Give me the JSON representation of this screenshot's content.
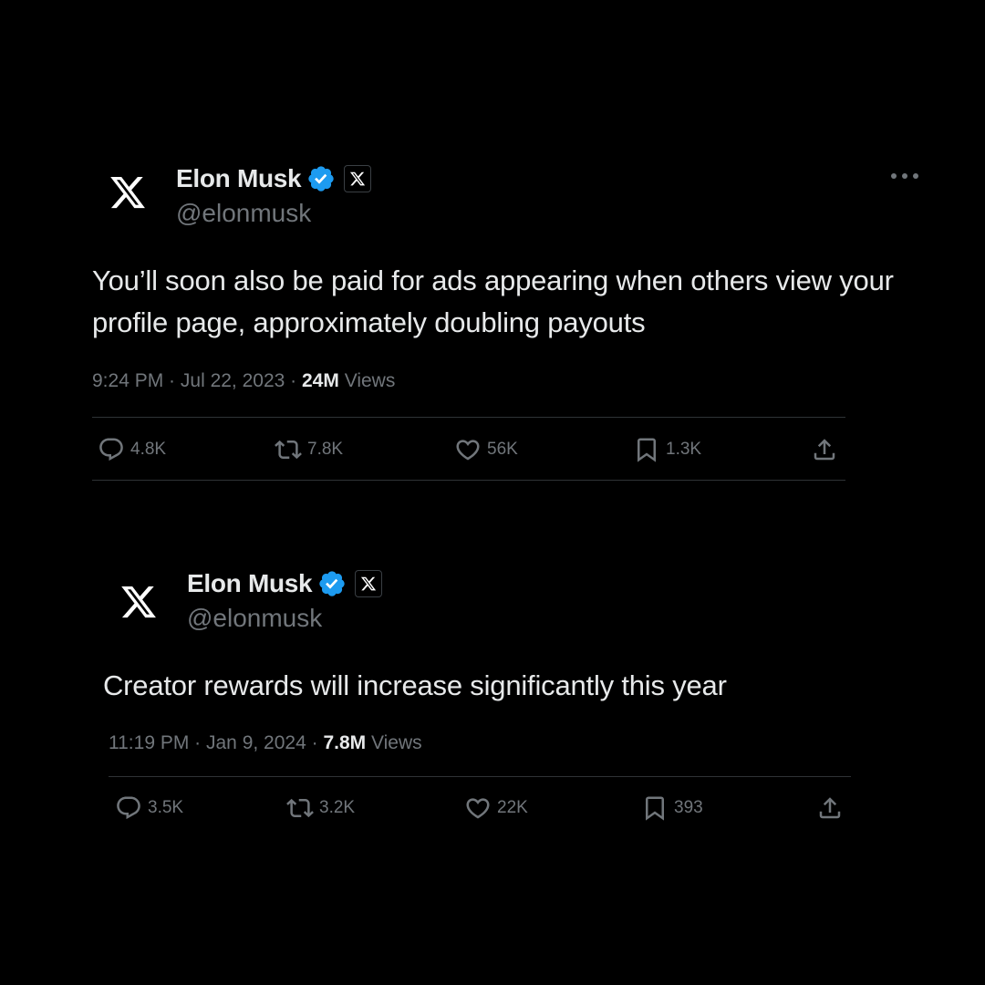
{
  "tweets": [
    {
      "author": {
        "name": "Elon Musk",
        "handle": "@elonmusk",
        "verified": true,
        "affiliate_badge": "x-logo-icon",
        "avatar_icon": "x-logo-icon"
      },
      "text": "You’ll soon also be paid for ads appearing when others view your profile page, approximately doubling payouts",
      "time": "9:24 PM",
      "date": "Jul 22, 2023",
      "views": "24M",
      "views_label": "Views",
      "stats": {
        "replies": "4.8K",
        "reposts": "7.8K",
        "likes": "56K",
        "bookmarks": "1.3K"
      }
    },
    {
      "author": {
        "name": "Elon Musk",
        "handle": "@elonmusk",
        "verified": true,
        "affiliate_badge": "x-logo-icon",
        "avatar_icon": "x-logo-icon"
      },
      "text": "Creator rewards will increase significantly this year",
      "time": "11:19 PM",
      "date": "Jan 9, 2024",
      "views": "7.8M",
      "views_label": "Views",
      "stats": {
        "replies": "3.5K",
        "reposts": "3.2K",
        "likes": "22K",
        "bookmarks": "393"
      }
    }
  ],
  "colors": {
    "background": "#000000",
    "text": "#e7e9ea",
    "secondary": "#71767b",
    "verified": "#1d9bf0",
    "divider": "#2f3336"
  }
}
